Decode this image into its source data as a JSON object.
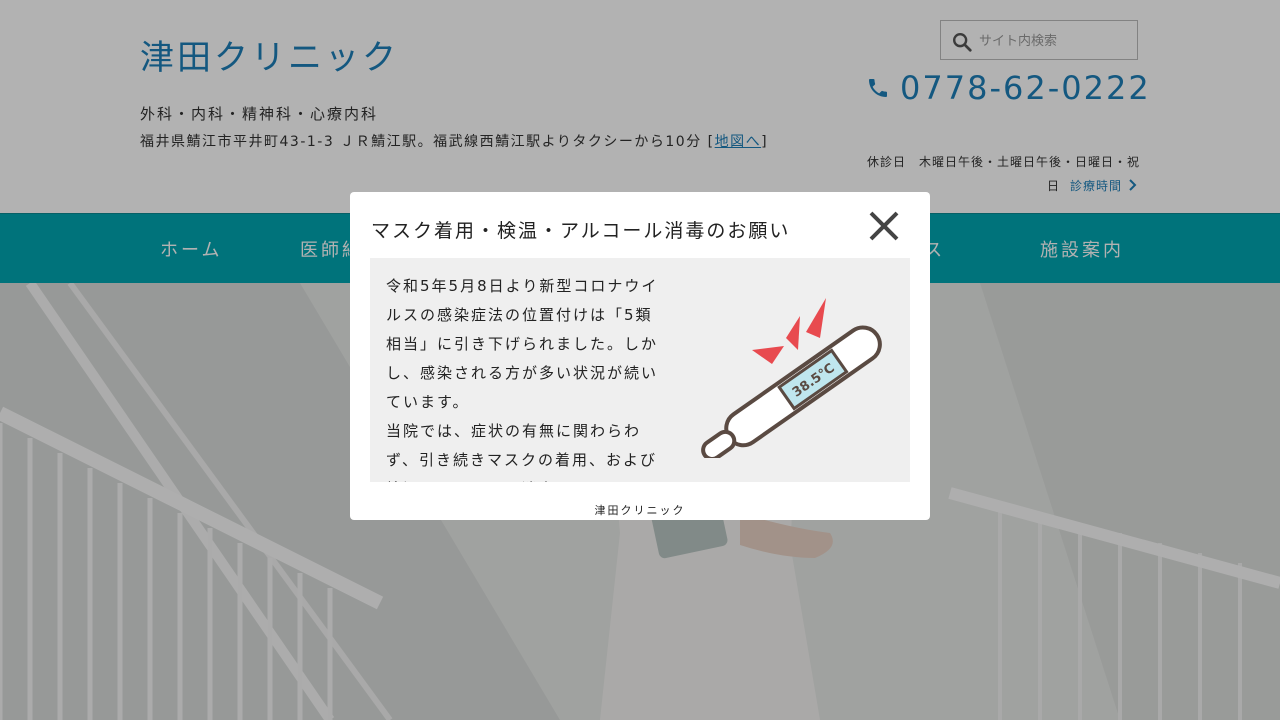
{
  "header": {
    "site_title": "津田クリニック",
    "subtitle": "外科・内科・精神科・心療内科",
    "address": "福井県鯖江市平井町43-1-3 ＪＲ鯖江駅。福武線西鯖江駅よりタクシーから10分 [",
    "map_link": "地図へ",
    "address_close": "]",
    "search": {
      "placeholder": "サイト内検索",
      "value": ""
    },
    "phone": "0778-62-0222",
    "closed_days": "休診日　木曜日午後・土曜日午後・日曜日・祝日",
    "hours_link": "診療時間"
  },
  "nav": {
    "items": [
      {
        "label": "ホーム"
      },
      {
        "label": "医師紹介"
      },
      {
        "label": "アクセス"
      },
      {
        "label": "施設案内"
      }
    ]
  },
  "modal": {
    "title": "マスク着用・検温・アルコール消毒のお願い",
    "paragraph1": "令和5年5月8日より新型コロナウイルスの感染症法の位置付けは「5類相当」に引き下げられました。しかし、感染される方が多い状況が続いています。",
    "paragraph2": "当院では、症状の有無に関わらわず、引き続きマスクの着用、および検温とアルコール消毒をお願いいたします。",
    "thermometer_reading": "38.5℃",
    "footer": "津田クリニック"
  },
  "colors": {
    "accent": "#1e7fb8",
    "nav_bg": "#00a5b0",
    "overlay": "rgba(0,0,0,0.3)"
  },
  "icons": [
    "search-icon",
    "phone-icon",
    "chevron-right-icon",
    "close-icon",
    "thermometer-illustration"
  ]
}
